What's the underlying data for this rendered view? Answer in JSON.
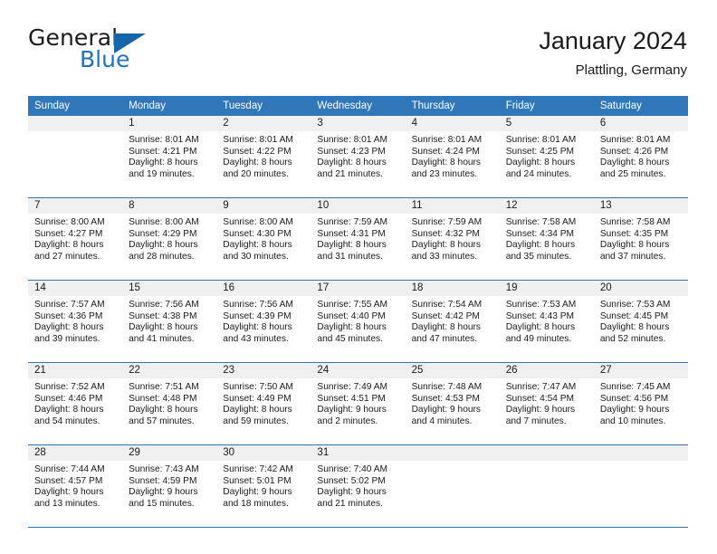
{
  "brand": {
    "word_general": "General",
    "word_blue": "Blue",
    "flag_icon": "triangle-flag-icon"
  },
  "header": {
    "title": "January 2024",
    "subtitle": "Plattling, Germany"
  },
  "colors": {
    "header_blue": "#2f77b8",
    "brand_blue": "#1e73be",
    "daynum_band": "#f0f0f0",
    "text": "#1a1a1a"
  },
  "calendar": {
    "weekday_headers": [
      "Sunday",
      "Monday",
      "Tuesday",
      "Wednesday",
      "Thursday",
      "Friday",
      "Saturday"
    ],
    "weeks": [
      [
        {
          "day": "",
          "lines": []
        },
        {
          "day": "1",
          "lines": [
            "Sunrise: 8:01 AM",
            "Sunset: 4:21 PM",
            "Daylight: 8 hours",
            "and 19 minutes."
          ]
        },
        {
          "day": "2",
          "lines": [
            "Sunrise: 8:01 AM",
            "Sunset: 4:22 PM",
            "Daylight: 8 hours",
            "and 20 minutes."
          ]
        },
        {
          "day": "3",
          "lines": [
            "Sunrise: 8:01 AM",
            "Sunset: 4:23 PM",
            "Daylight: 8 hours",
            "and 21 minutes."
          ]
        },
        {
          "day": "4",
          "lines": [
            "Sunrise: 8:01 AM",
            "Sunset: 4:24 PM",
            "Daylight: 8 hours",
            "and 23 minutes."
          ]
        },
        {
          "day": "5",
          "lines": [
            "Sunrise: 8:01 AM",
            "Sunset: 4:25 PM",
            "Daylight: 8 hours",
            "and 24 minutes."
          ]
        },
        {
          "day": "6",
          "lines": [
            "Sunrise: 8:01 AM",
            "Sunset: 4:26 PM",
            "Daylight: 8 hours",
            "and 25 minutes."
          ]
        }
      ],
      [
        {
          "day": "7",
          "lines": [
            "Sunrise: 8:00 AM",
            "Sunset: 4:27 PM",
            "Daylight: 8 hours",
            "and 27 minutes."
          ]
        },
        {
          "day": "8",
          "lines": [
            "Sunrise: 8:00 AM",
            "Sunset: 4:29 PM",
            "Daylight: 8 hours",
            "and 28 minutes."
          ]
        },
        {
          "day": "9",
          "lines": [
            "Sunrise: 8:00 AM",
            "Sunset: 4:30 PM",
            "Daylight: 8 hours",
            "and 30 minutes."
          ]
        },
        {
          "day": "10",
          "lines": [
            "Sunrise: 7:59 AM",
            "Sunset: 4:31 PM",
            "Daylight: 8 hours",
            "and 31 minutes."
          ]
        },
        {
          "day": "11",
          "lines": [
            "Sunrise: 7:59 AM",
            "Sunset: 4:32 PM",
            "Daylight: 8 hours",
            "and 33 minutes."
          ]
        },
        {
          "day": "12",
          "lines": [
            "Sunrise: 7:58 AM",
            "Sunset: 4:34 PM",
            "Daylight: 8 hours",
            "and 35 minutes."
          ]
        },
        {
          "day": "13",
          "lines": [
            "Sunrise: 7:58 AM",
            "Sunset: 4:35 PM",
            "Daylight: 8 hours",
            "and 37 minutes."
          ]
        }
      ],
      [
        {
          "day": "14",
          "lines": [
            "Sunrise: 7:57 AM",
            "Sunset: 4:36 PM",
            "Daylight: 8 hours",
            "and 39 minutes."
          ]
        },
        {
          "day": "15",
          "lines": [
            "Sunrise: 7:56 AM",
            "Sunset: 4:38 PM",
            "Daylight: 8 hours",
            "and 41 minutes."
          ]
        },
        {
          "day": "16",
          "lines": [
            "Sunrise: 7:56 AM",
            "Sunset: 4:39 PM",
            "Daylight: 8 hours",
            "and 43 minutes."
          ]
        },
        {
          "day": "17",
          "lines": [
            "Sunrise: 7:55 AM",
            "Sunset: 4:40 PM",
            "Daylight: 8 hours",
            "and 45 minutes."
          ]
        },
        {
          "day": "18",
          "lines": [
            "Sunrise: 7:54 AM",
            "Sunset: 4:42 PM",
            "Daylight: 8 hours",
            "and 47 minutes."
          ]
        },
        {
          "day": "19",
          "lines": [
            "Sunrise: 7:53 AM",
            "Sunset: 4:43 PM",
            "Daylight: 8 hours",
            "and 49 minutes."
          ]
        },
        {
          "day": "20",
          "lines": [
            "Sunrise: 7:53 AM",
            "Sunset: 4:45 PM",
            "Daylight: 8 hours",
            "and 52 minutes."
          ]
        }
      ],
      [
        {
          "day": "21",
          "lines": [
            "Sunrise: 7:52 AM",
            "Sunset: 4:46 PM",
            "Daylight: 8 hours",
            "and 54 minutes."
          ]
        },
        {
          "day": "22",
          "lines": [
            "Sunrise: 7:51 AM",
            "Sunset: 4:48 PM",
            "Daylight: 8 hours",
            "and 57 minutes."
          ]
        },
        {
          "day": "23",
          "lines": [
            "Sunrise: 7:50 AM",
            "Sunset: 4:49 PM",
            "Daylight: 8 hours",
            "and 59 minutes."
          ]
        },
        {
          "day": "24",
          "lines": [
            "Sunrise: 7:49 AM",
            "Sunset: 4:51 PM",
            "Daylight: 9 hours",
            "and 2 minutes."
          ]
        },
        {
          "day": "25",
          "lines": [
            "Sunrise: 7:48 AM",
            "Sunset: 4:53 PM",
            "Daylight: 9 hours",
            "and 4 minutes."
          ]
        },
        {
          "day": "26",
          "lines": [
            "Sunrise: 7:47 AM",
            "Sunset: 4:54 PM",
            "Daylight: 9 hours",
            "and 7 minutes."
          ]
        },
        {
          "day": "27",
          "lines": [
            "Sunrise: 7:45 AM",
            "Sunset: 4:56 PM",
            "Daylight: 9 hours",
            "and 10 minutes."
          ]
        }
      ],
      [
        {
          "day": "28",
          "lines": [
            "Sunrise: 7:44 AM",
            "Sunset: 4:57 PM",
            "Daylight: 9 hours",
            "and 13 minutes."
          ]
        },
        {
          "day": "29",
          "lines": [
            "Sunrise: 7:43 AM",
            "Sunset: 4:59 PM",
            "Daylight: 9 hours",
            "and 15 minutes."
          ]
        },
        {
          "day": "30",
          "lines": [
            "Sunrise: 7:42 AM",
            "Sunset: 5:01 PM",
            "Daylight: 9 hours",
            "and 18 minutes."
          ]
        },
        {
          "day": "31",
          "lines": [
            "Sunrise: 7:40 AM",
            "Sunset: 5:02 PM",
            "Daylight: 9 hours",
            "and 21 minutes."
          ]
        },
        {
          "day": "",
          "lines": []
        },
        {
          "day": "",
          "lines": []
        },
        {
          "day": "",
          "lines": []
        }
      ]
    ]
  }
}
